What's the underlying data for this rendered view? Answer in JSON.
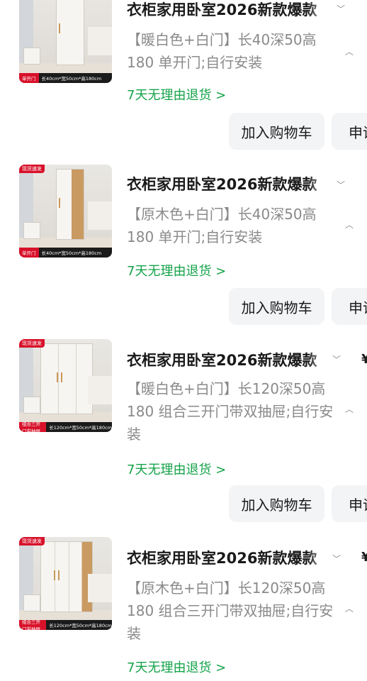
{
  "items": [
    {
      "title": "衣柜家用卧室2026新款爆款",
      "spec": "【暖白色+白门】长40深50高180 单开门;自行安装",
      "promise": "7天无理由退货 >",
      "cart_label": "加入购物车",
      "apply_label": "申请",
      "thumb_door": "单开门",
      "thumb_size": "长40cm*宽50cm*高180cm",
      "thumb_badge": "",
      "price": ""
    },
    {
      "title": "衣柜家用卧室2026新款爆款",
      "spec": "【原木色+白门】长40深50高180 单开门;自行安装",
      "promise": "7天无理由退货 >",
      "cart_label": "加入购物车",
      "apply_label": "申请",
      "thumb_door": "单开门",
      "thumb_size": "长40cm*宽50cm*高180cm",
      "thumb_badge": "现货速发",
      "price": ""
    },
    {
      "title": "衣柜家用卧室2026新款爆款",
      "spec": "【暖白色+白门】长120深50高180 组合三开门带双抽屉;自行安装",
      "promise": "7天无理由退货 >",
      "cart_label": "加入购物车",
      "apply_label": "申请",
      "thumb_door": "组合三开门带抽屉",
      "thumb_size": "长120cm*宽50cm*高180cm",
      "thumb_badge": "现货速发",
      "price": "¥"
    },
    {
      "title": "衣柜家用卧室2026新款爆款",
      "spec": "【原木色+白门】长120深50高180 组合三开门带双抽屉;自行安装",
      "promise": "7天无理由退货 >",
      "cart_label": "加入购物车",
      "apply_label": "申请",
      "thumb_door": "组合三开门带抽屉",
      "thumb_size": "长120cm*宽50cm*高180cm",
      "thumb_badge": "现货速发",
      "price": "¥"
    }
  ],
  "icons": {
    "chevron_down": "﹀",
    "chevron_up": "︿"
  },
  "colors": {
    "promise_green": "#15a34a",
    "badge_red": "#d8112a",
    "button_bg": "#f3f4f6"
  }
}
